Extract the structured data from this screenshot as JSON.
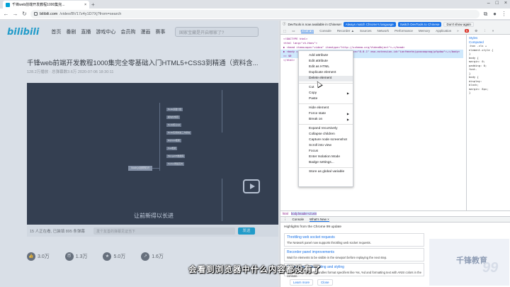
{
  "browser": {
    "tab_title": "千锋web前端开发教程1000集完...",
    "url_host": "bilibili.com",
    "url_path": "/video/BV17z4y1D7Xj?from=search"
  },
  "page": {
    "logo": "bilibili",
    "nav": [
      "首页",
      "番剧",
      "直播",
      "游戏中心",
      "会员购",
      "漫画",
      "赛事"
    ],
    "search_placeholder": "国家宝藏是开启哪家了?",
    "video_title": "千锋web前端开发教程1000集完全零基础入门HTML5+CSS3到精通（资料含...",
    "video_meta": "128.2万播放 · 总弹幕数3.6万   2020-07-06 18:30:11",
    "player_subtitle": "让前新得以长进",
    "mind_root": "Node.js回顾知识",
    "mind_nodes": [
      "Node基础介绍",
      "模块化规范",
      "Node核心api",
      "Node实用的第三方模块",
      "Express框架",
      "Koa框架",
      "MongoDB数据库",
      "Socket网络实时"
    ],
    "danmaku_info": "15 人正在看, 已装填 895 条弹幕",
    "danmaku_placeholder": "发个友善的弹幕见证当下",
    "danmaku_send": "发送",
    "stats": [
      {
        "icon": "like-icon",
        "glyph": "👍",
        "value": "3.0万"
      },
      {
        "icon": "coin-icon",
        "glyph": "币",
        "value": "1.3万"
      },
      {
        "icon": "star-icon",
        "glyph": "★",
        "value": "5.0万"
      },
      {
        "icon": "share-icon",
        "glyph": "↗",
        "value": "1.6万"
      }
    ]
  },
  "devtools": {
    "info_text": "DevTools is now available in Chinese!",
    "info_btn1": "Always match Chrome's language",
    "info_btn2": "Switch DevTools to Chinese",
    "info_btn3": "Don't show again",
    "tabs": [
      "Elements",
      "Console",
      "Recorder ▲",
      "Sources",
      "Network",
      "Performance",
      "Memory",
      "Application",
      "»"
    ],
    "error_count": "6",
    "dom_lines": [
      "<!DOCTYPE html>",
      "<html lang=\"zh-Hans\">",
      "▶ <head itemscope=\"video\" itemtype=\"http://schema.org/VideoObject\">…</head>",
      "▶ <body class=\"\" style=\"\" data-plugin-version=\"8.0.1\" mso-extension-id=\"ionfmnehnjgcoooopnogjpfgdaw\">…</body>",
      "  == $0",
      "</html>"
    ],
    "styles_lines": [
      "Styles",
      "Computed",
      ":hov .cls +",
      "element.style {",
      "}",
      "body {",
      "  margin: 0;",
      "  padding: 0;",
      "  font-",
      "}",
      "body {",
      "  display:",
      "  block;",
      "  margin: 8px;",
      "}"
    ],
    "breadcrumb": [
      "html",
      "body.header-v3.win"
    ],
    "drawer_tabs": [
      "Console",
      "What's New ×"
    ],
    "whats_new_head": "Highlights from the Chrome 99 update",
    "whats_new": [
      {
        "title": "Throttling web socket requests",
        "desc": "The Network panel now supports throttling web socket requests."
      },
      {
        "title": "Recorder panel improvements",
        "desc": "Wait for elements to be visible in the viewport before replaying the next step."
      },
      {
        "title": "Better console formatting and styling",
        "desc": "Console now properly handles format specifiers like %s, %d and formatting text with ANSI colors in the console."
      }
    ],
    "learn_more": "Learn more",
    "close": "Close",
    "promo": "千锋教育",
    "promo_num": "99"
  },
  "context_menu": {
    "items": [
      {
        "label": "Add attribute",
        "submenu": false
      },
      {
        "label": "Edit attribute",
        "submenu": false
      },
      {
        "label": "Edit as HTML",
        "submenu": false
      },
      {
        "label": "Duplicate element",
        "submenu": false
      },
      {
        "label": "Delete element",
        "submenu": false,
        "highlighted": true
      },
      {
        "sep": true
      },
      {
        "label": "Cut",
        "submenu": false
      },
      {
        "label": "Copy",
        "submenu": true
      },
      {
        "label": "Paste",
        "submenu": false
      },
      {
        "sep": true
      },
      {
        "label": "Hide element",
        "submenu": false
      },
      {
        "label": "Force state",
        "submenu": true
      },
      {
        "label": "Break on",
        "submenu": true
      },
      {
        "sep": true
      },
      {
        "label": "Expand recursively",
        "submenu": false
      },
      {
        "label": "Collapse children",
        "submenu": false
      },
      {
        "label": "Capture node screenshot",
        "submenu": false
      },
      {
        "label": "Scroll into view",
        "submenu": false
      },
      {
        "label": "Focus",
        "submenu": false
      },
      {
        "label": "Enter Isolation Mode",
        "submenu": false
      },
      {
        "label": "Badge settings...",
        "submenu": false
      },
      {
        "sep": true
      },
      {
        "label": "Store as global variable",
        "submenu": false
      }
    ]
  },
  "caption": "会看到浏览器中什么内容都没有了"
}
